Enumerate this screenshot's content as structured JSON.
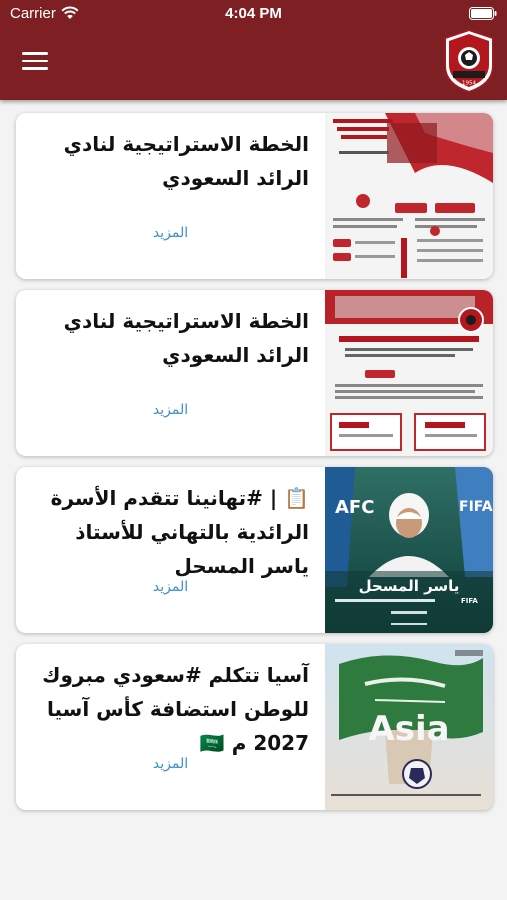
{
  "status_bar": {
    "carrier": "Carrier",
    "time": "4:04 PM"
  },
  "header": {
    "background_color": "#7e1f23",
    "menu_icon": "hamburger-menu-icon",
    "logo_icon": "club-crest-icon",
    "logo_year": "1954"
  },
  "news": [
    {
      "title": "الخطة الاستراتيجية لنادي الرائد السعودي",
      "more_label": "المزيد",
      "thumbnail": "strategic-plan-infographic"
    },
    {
      "title": "الخطة الاستراتيجية لنادي الرائد السعودي",
      "more_label": "المزيد",
      "thumbnail": "strategic-plan-infographic"
    },
    {
      "title": "📋 | #تهانينا تتقدم الأسرة الرائدية بالتهاني للأستاذ ياسر المسحل",
      "more_label": "المزيد",
      "thumbnail": "yasser-almisehal-fifa-council",
      "thumbnail_name": "ياسر المسحل"
    },
    {
      "title": "آسيا تتكلم #سعودي مبروك للوطن استضافة كأس آسيا 2027 م 🇸🇦",
      "more_label": "المزيد",
      "thumbnail": "asia-cup-2027-saudi-flag"
    }
  ],
  "accent_color": "#3a8fd0"
}
